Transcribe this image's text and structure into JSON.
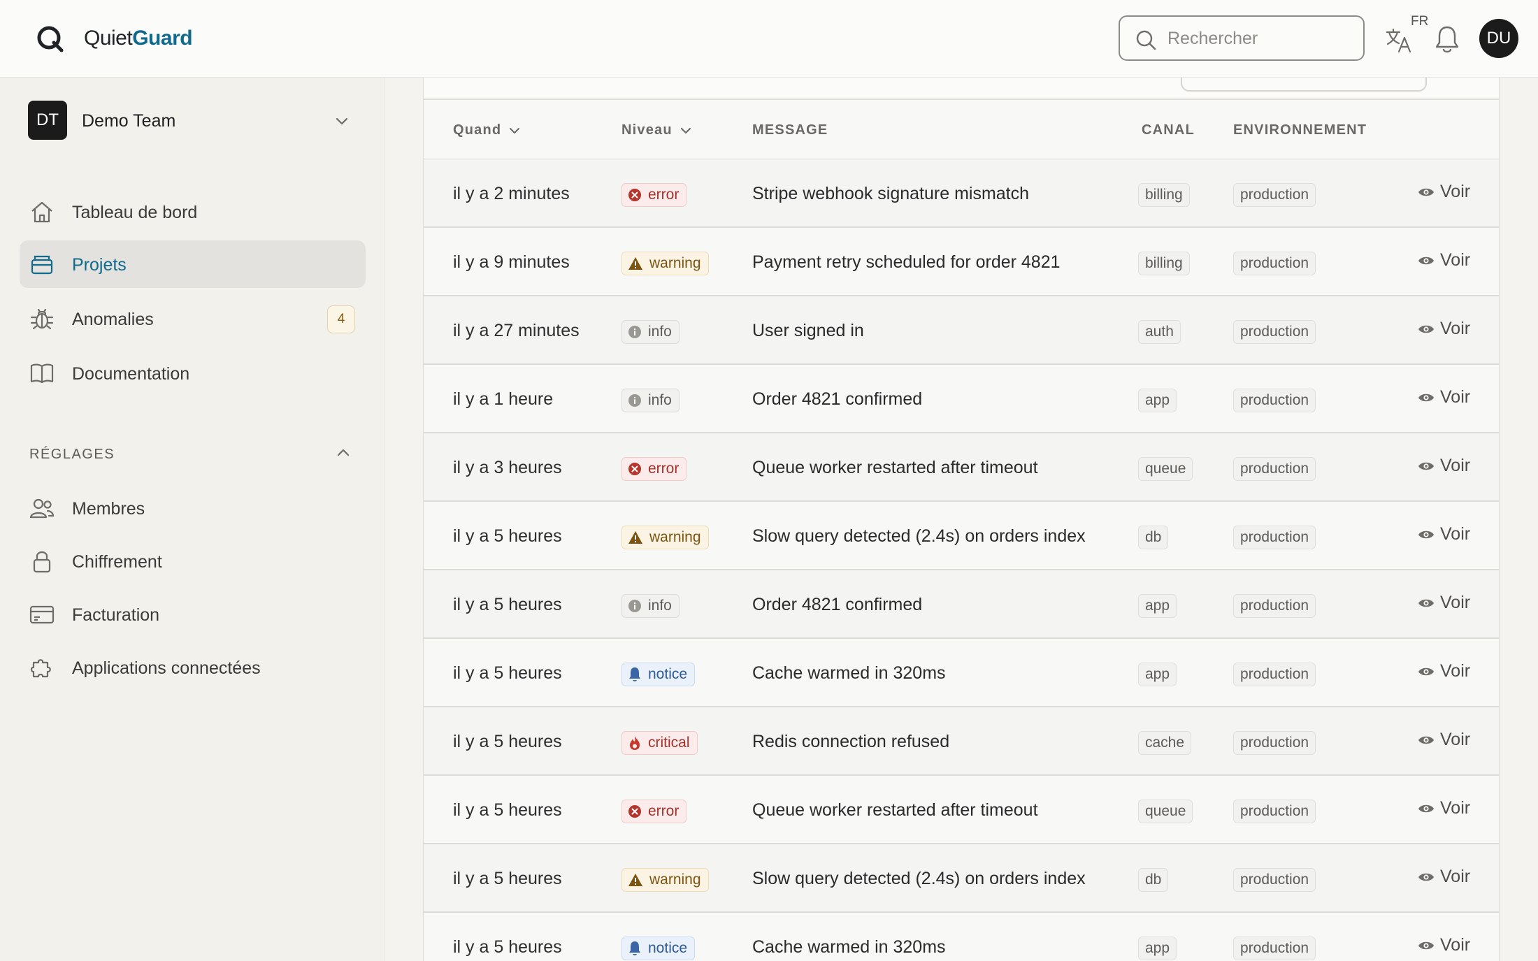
{
  "app": {
    "logo_prefix": "Quiet",
    "logo_brand": "Guard"
  },
  "header": {
    "search_placeholder": "Rechercher",
    "lang_badge": "FR",
    "avatar_initials": "DU"
  },
  "sidebar": {
    "team_initials": "DT",
    "team_name": "Demo Team",
    "nav": [
      {
        "label": "Tableau de bord",
        "icon": "home-icon"
      },
      {
        "label": "Projets",
        "icon": "folder-icon",
        "active": true
      },
      {
        "label": "Anomalies",
        "icon": "bug-icon",
        "badge": "4"
      },
      {
        "label": "Documentation",
        "icon": "book-icon"
      }
    ],
    "settings_title": "RÉGLAGES",
    "settings": [
      {
        "label": "Membres",
        "icon": "users-icon"
      },
      {
        "label": "Chiffrement",
        "icon": "lock-icon"
      },
      {
        "label": "Facturation",
        "icon": "credit-card-icon"
      },
      {
        "label": "Applications connectées",
        "icon": "puzzle-icon"
      }
    ]
  },
  "table": {
    "headers": {
      "when": "Quand",
      "level": "Niveau",
      "message": "MESSAGE",
      "channel": "CANAL",
      "environment": "ENVIRONNEMENT"
    },
    "view_label": "Voir",
    "rows": [
      {
        "when": "il y a 2 minutes",
        "level": "error",
        "message": "Stripe webhook signature mismatch",
        "channel": "billing",
        "environment": "production"
      },
      {
        "when": "il y a 9 minutes",
        "level": "warning",
        "message": "Payment retry scheduled for order 4821",
        "channel": "billing",
        "environment": "production"
      },
      {
        "when": "il y a 27 minutes",
        "level": "info",
        "message": "User signed in",
        "channel": "auth",
        "environment": "production"
      },
      {
        "when": "il y a 1 heure",
        "level": "info",
        "message": "Order 4821 confirmed",
        "channel": "app",
        "environment": "production"
      },
      {
        "when": "il y a 3 heures",
        "level": "error",
        "message": "Queue worker restarted after timeout",
        "channel": "queue",
        "environment": "production"
      },
      {
        "when": "il y a 5 heures",
        "level": "warning",
        "message": "Slow query detected (2.4s) on orders index",
        "channel": "db",
        "environment": "production"
      },
      {
        "when": "il y a 5 heures",
        "level": "info",
        "message": "Order 4821 confirmed",
        "channel": "app",
        "environment": "production"
      },
      {
        "when": "il y a 5 heures",
        "level": "notice",
        "message": "Cache warmed in 320ms",
        "channel": "app",
        "environment": "production"
      },
      {
        "when": "il y a 5 heures",
        "level": "critical",
        "message": "Redis connection refused",
        "channel": "cache",
        "environment": "production"
      },
      {
        "when": "il y a 5 heures",
        "level": "error",
        "message": "Queue worker restarted after timeout",
        "channel": "queue",
        "environment": "production"
      },
      {
        "when": "il y a 5 heures",
        "level": "warning",
        "message": "Slow query detected (2.4s) on orders index",
        "channel": "db",
        "environment": "production"
      },
      {
        "when": "il y a 5 heures",
        "level": "notice",
        "message": "Cache warmed in 320ms",
        "channel": "app",
        "environment": "production"
      }
    ]
  },
  "colors": {
    "brand": "#0f6a8c",
    "error": "#a4312a",
    "warning": "#7a5410",
    "notice": "#2e5a94"
  }
}
